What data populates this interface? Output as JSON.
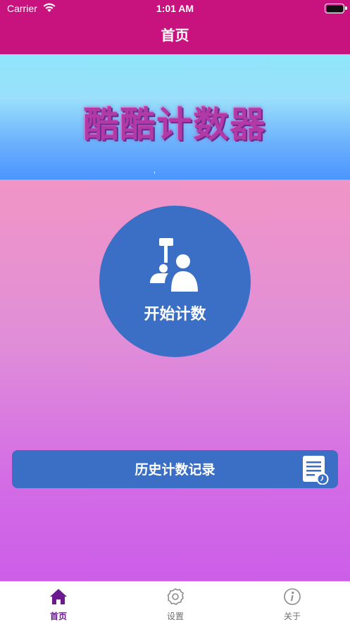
{
  "status_bar": {
    "carrier": "Carrier",
    "time": "1:01 AM",
    "wifi_icon": "wifi-icon",
    "battery_icon": "battery-icon"
  },
  "nav": {
    "title": "首页"
  },
  "banner": {
    "title": "酷酷计数器"
  },
  "start": {
    "label": "开始计数",
    "icon": "counting-person-icon"
  },
  "history": {
    "label": "历史计数记录",
    "icon": "history-document-icon"
  },
  "tabs": [
    {
      "label": "首页",
      "icon": "home-icon",
      "active": true
    },
    {
      "label": "设置",
      "icon": "settings-gear-icon",
      "active": false
    },
    {
      "label": "关于",
      "icon": "info-icon",
      "active": false
    }
  ],
  "colors": {
    "brand_bar": "#c8137e",
    "button_blue": "#3b6fc6",
    "active_tab": "#6a1a8c",
    "inactive_tab": "#6d6d6d"
  }
}
